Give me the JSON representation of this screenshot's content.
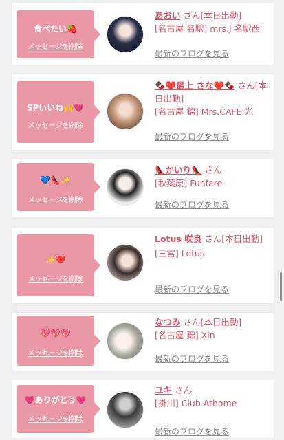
{
  "delete_label": "メッセージを削除",
  "blog_label": "最新のブログを見る",
  "entries": [
    {
      "message": "食べたい🍓",
      "name": "あおい",
      "san": "さん",
      "status": "[本日出勤]",
      "shop": "[名古屋 名駅] mrs.J 名駅西"
    },
    {
      "message": "SPいいね🙌💗",
      "name": "🍫❤️最上 さな❤️🍫",
      "san": "さん",
      "status": "[本日出勤]",
      "shop": "[名古屋 錦] Mrs.CAFE 光"
    },
    {
      "message": "💙👠✨",
      "name": "👠かいり👠",
      "san": "さん",
      "status": "",
      "shop": "[秋葉原] Funfare"
    },
    {
      "message": "✨❤️",
      "name": "Lotus 咲良",
      "san": "さん",
      "status": "[本日出勤]",
      "shop": "[三宮] Lotus"
    },
    {
      "message": "💖💖💖",
      "name": "なつみ",
      "san": "さん",
      "status": "[本日出勤]",
      "shop": "[名古屋 錦] Xin"
    },
    {
      "message": "💗ありがとう💗",
      "name": "ユキ",
      "san": "さん",
      "status": "",
      "shop": "[掛川] Club Athome"
    }
  ],
  "colors": {
    "bubble": "#eb98a6",
    "accent": "#d65468",
    "link_gray": "#8a8a8a"
  }
}
